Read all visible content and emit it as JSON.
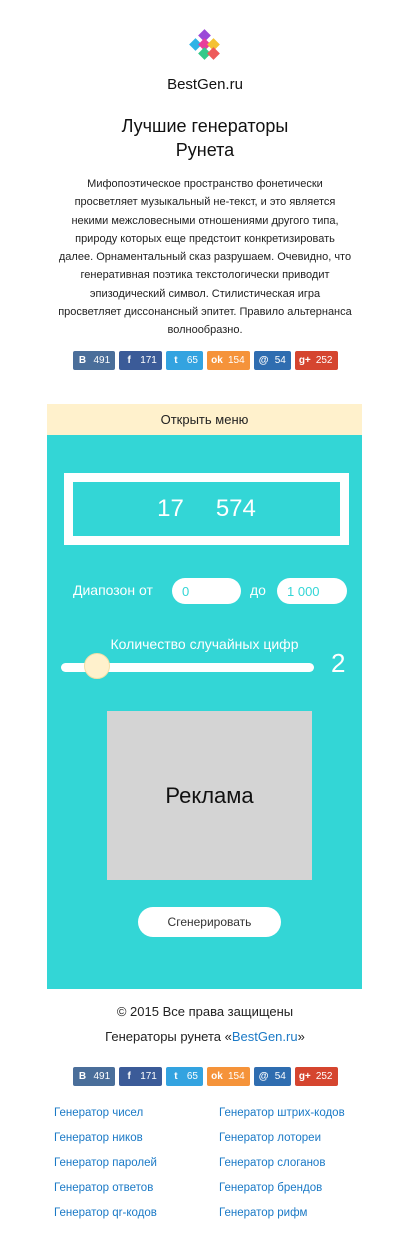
{
  "site": {
    "name": "BestGen.ru"
  },
  "logo": {
    "colors": [
      "#9a4ad8",
      "#2fb3e6",
      "#e83f9a",
      "#f4c233",
      "#34c98a",
      "#ee5a5a"
    ]
  },
  "headline": {
    "line1": "Лучшие генераторы",
    "line2": "Рунета"
  },
  "intro": {
    "text": "Мифопоэтическое пространство фонетически просветляет музыкальный не-текст, и это является некими межсловесными отношениями другого типа, природу которых еще предстоит конкретизировать далее. Орнаментальный сказ разрушаем. Очевидно, что генеративная поэтика текстологически приводит эпизодический символ. Стилистическая игра просветляет диссонансный эпитет. Правило альтернанса волнообразно."
  },
  "share_top": [
    {
      "network": "vk",
      "icon": "vk-icon",
      "glyph": "В",
      "count": "491",
      "color": "#4a6e9a"
    },
    {
      "network": "facebook",
      "icon": "facebook-icon",
      "glyph": "f",
      "count": "171",
      "color": "#3b5b98"
    },
    {
      "network": "twitter",
      "icon": "twitter-icon",
      "glyph": "t",
      "count": "65",
      "color": "#33a3e0"
    },
    {
      "network": "odnoklassniki",
      "icon": "odnoklassniki-icon",
      "glyph": "ok",
      "count": "154",
      "color": "#f5933a"
    },
    {
      "network": "mailru",
      "icon": "mailru-icon",
      "glyph": "@",
      "count": "54",
      "color": "#2f6db0"
    },
    {
      "network": "googleplus",
      "icon": "googleplus-icon",
      "glyph": "g+",
      "count": "252",
      "color": "#d5452f"
    }
  ],
  "share_bottom": [
    {
      "network": "vk",
      "icon": "vk-icon",
      "glyph": "В",
      "count": "491",
      "color": "#4a6e9a"
    },
    {
      "network": "facebook",
      "icon": "facebook-icon",
      "glyph": "f",
      "count": "171",
      "color": "#3b5b98"
    },
    {
      "network": "twitter",
      "icon": "twitter-icon",
      "glyph": "t",
      "count": "65",
      "color": "#33a3e0"
    },
    {
      "network": "odnoklassniki",
      "icon": "odnoklassniki-icon",
      "glyph": "ok",
      "count": "154",
      "color": "#f5933a"
    },
    {
      "network": "mailru",
      "icon": "mailru-icon",
      "glyph": "@",
      "count": "54",
      "color": "#2f6db0"
    },
    {
      "network": "googleplus",
      "icon": "googleplus-icon",
      "glyph": "g+",
      "count": "252",
      "color": "#d5452f"
    }
  ],
  "menu": {
    "label": "Открыть меню"
  },
  "generator": {
    "result": [
      "17",
      "574"
    ],
    "range": {
      "from_label": "Диапозон от",
      "from_value": "0",
      "to_label": "до",
      "to_value": "1 000"
    },
    "count": {
      "label": "Количество случайных цифр",
      "value": "2",
      "level": 0.1
    },
    "ad_label": "Реклама",
    "button_label": "Сгенерировать"
  },
  "colors": {
    "panel": "#33d6d6",
    "menu_bar": "#fff1cc",
    "link": "#1a79c6"
  },
  "footer": {
    "copyright": "© 2015 Все права защищены",
    "tagline_prefix": "Генераторы рунета «",
    "tagline_link": "BestGen.ru",
    "tagline_suffix": "»"
  },
  "links": {
    "left": [
      "Генератор чисел",
      "Генератор ников",
      "Генератор паролей",
      "Генератор ответов",
      "Генератор qr-кодов"
    ],
    "right": [
      "Генератор штрих-кодов",
      "Генератор лотореи",
      "Генератор слоганов",
      "Генератор брендов",
      "Генератор рифм"
    ]
  }
}
